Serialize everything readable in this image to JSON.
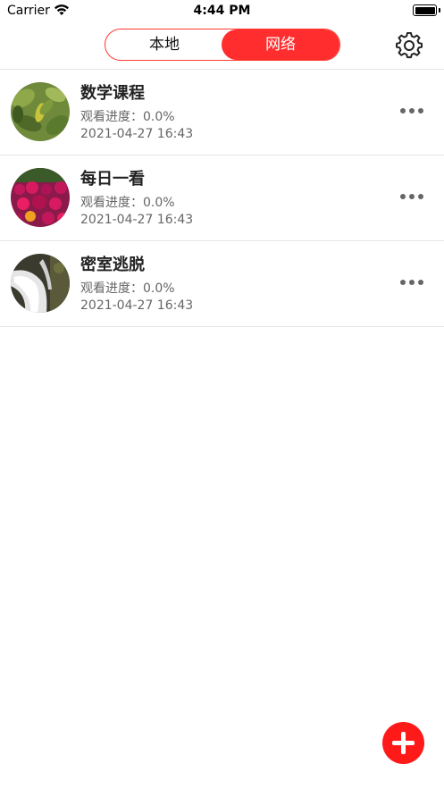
{
  "status_bar": {
    "carrier": "Carrier",
    "time": "4:44 PM"
  },
  "segment": {
    "local_label": "本地",
    "network_label": "网络",
    "selected": "网络"
  },
  "icons": {
    "settings": "gear-icon",
    "more": "ellipsis-icon",
    "add": "plus-icon"
  },
  "colors": {
    "accent": "#ff2d2d",
    "divider": "#e3e3e3",
    "secondary_text": "#666666"
  },
  "items": [
    {
      "title": "数学课程",
      "progress": "观看进度：0.0%",
      "date": "2021-04-27 16:43"
    },
    {
      "title": "每日一看",
      "progress": "观看进度：0.0%",
      "date": "2021-04-27 16:43"
    },
    {
      "title": "密室逃脱",
      "progress": "观看进度：0.0%",
      "date": "2021-04-27 16:43"
    }
  ]
}
